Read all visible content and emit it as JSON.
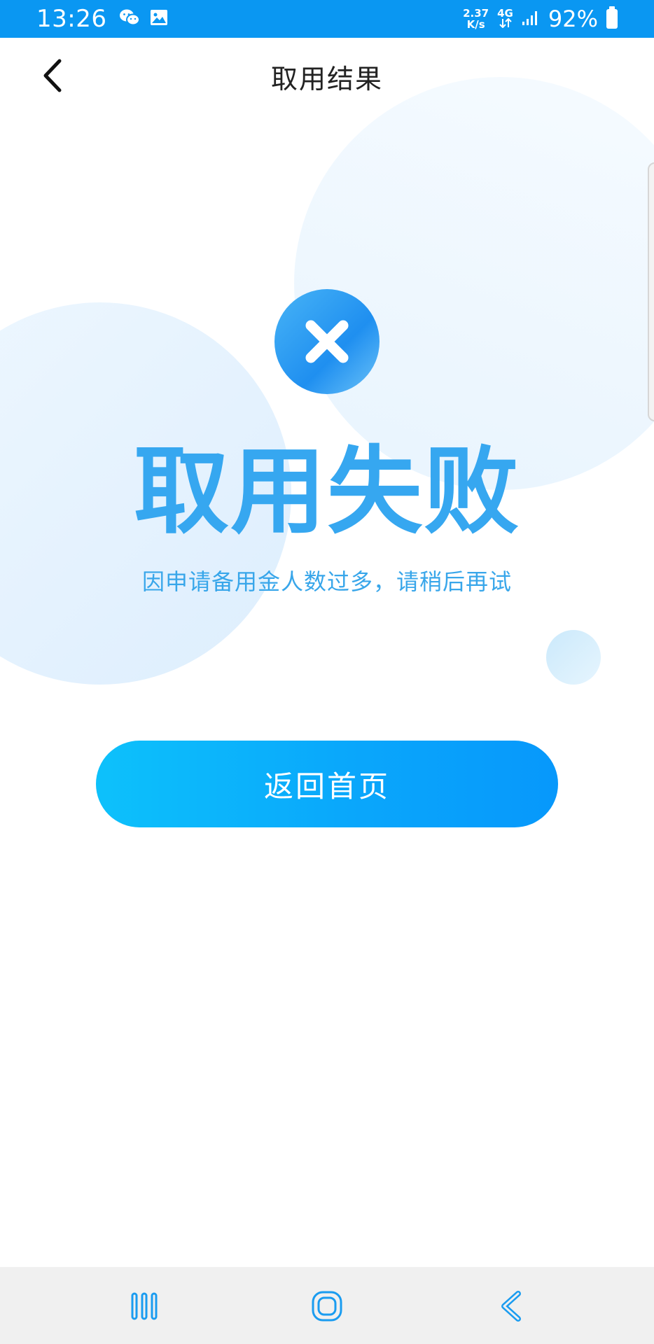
{
  "status_bar": {
    "time": "13:26",
    "net_speed_value": "2.37",
    "net_speed_unit": "K/s",
    "network_type": "4G",
    "battery": "92%",
    "icons": [
      "wechat-icon",
      "gallery-icon",
      "data-arrows-icon",
      "signal-icon",
      "battery-icon"
    ],
    "color": "#0a97f2"
  },
  "header": {
    "title": "取用结果",
    "back_icon": "chevron-left-icon"
  },
  "result": {
    "icon": "close-circle-icon",
    "title": "取用失败",
    "description": "因申请备用金人数过多，请稍后再试",
    "accent_color": "#36a7f0"
  },
  "actions": {
    "home_button_label": "返回首页"
  },
  "nav_bar": {
    "icons": [
      "recent-apps-icon",
      "home-icon",
      "back-icon"
    ]
  }
}
